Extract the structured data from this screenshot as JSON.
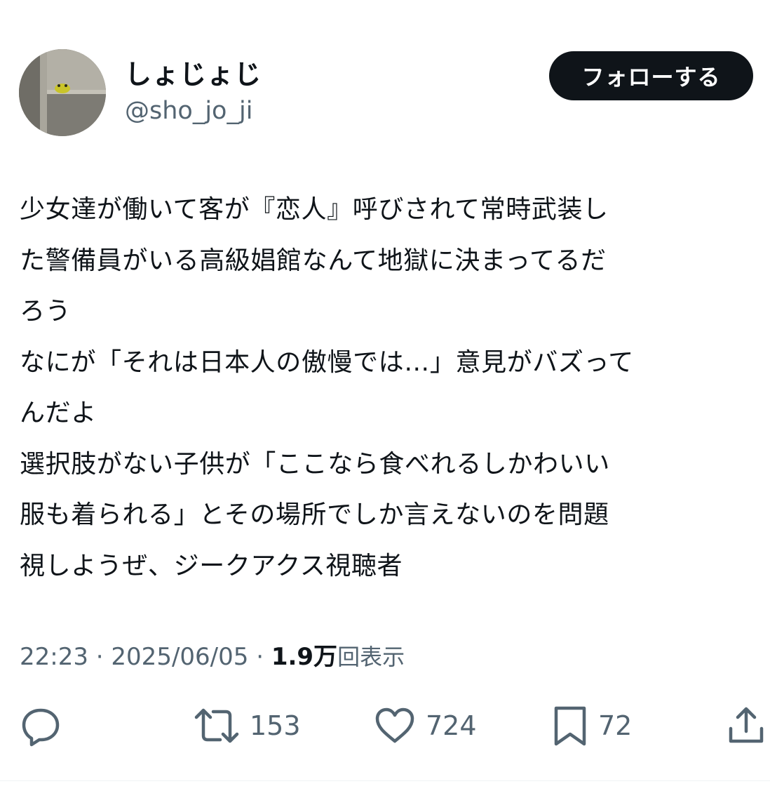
{
  "author": {
    "display_name": "しょじょじ",
    "handle": "@sho_jo_ji"
  },
  "follow_button": {
    "label": "フォローする"
  },
  "tweet": {
    "lines": [
      "少女達が働いて客が『恋人』呼びされて常時武装し",
      "た警備員がいる高級娼館なんて地獄に決まってるだ",
      "ろう",
      "なにが「それは日本人の傲慢では…」意見がバズって",
      "んだよ",
      "選択肢がない子供が「ここなら食べれるしかわいい",
      "服も着られる」とその場所でしか言えないのを問題",
      "視しようぜ、ジークアクス視聴者"
    ]
  },
  "meta": {
    "time": "22:23",
    "date": "2025/06/05",
    "separator": " · ",
    "views_count": "1.9万",
    "views_label": "回表示"
  },
  "actions": {
    "reply": {
      "icon": "reply-icon"
    },
    "retweet": {
      "icon": "retweet-icon",
      "count": "153"
    },
    "like": {
      "icon": "heart-icon",
      "count": "724"
    },
    "bookmark": {
      "icon": "bookmark-icon",
      "count": "72"
    },
    "share": {
      "icon": "share-icon"
    }
  },
  "colors": {
    "text": "#0f1419",
    "secondary": "#536471",
    "button_bg": "#0f1419",
    "button_text": "#ffffff"
  }
}
